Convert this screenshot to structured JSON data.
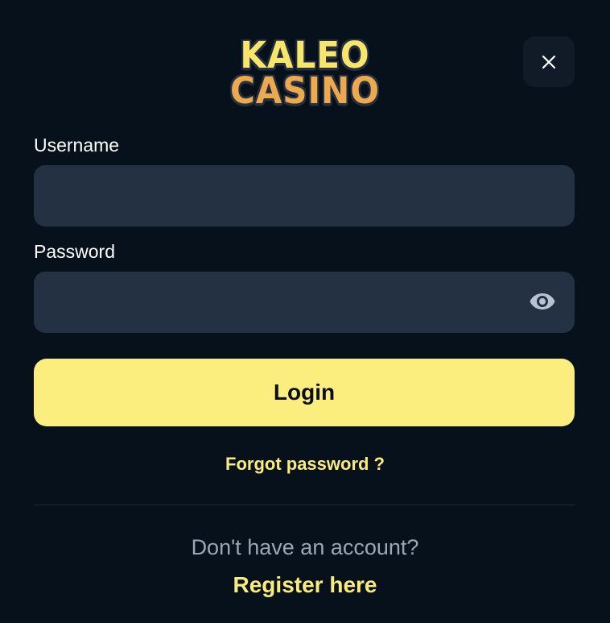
{
  "logo": {
    "line1": "KALEO",
    "line2": "CASINO"
  },
  "header": {
    "close_icon": "close-icon"
  },
  "form": {
    "username_label": "Username",
    "username_value": "",
    "password_label": "Password",
    "password_value": "",
    "password_toggle_icon": "eye-icon",
    "login_label": "Login",
    "forgot_label": "Forgot password ?"
  },
  "footer": {
    "no_account_text": "Don't have an account?",
    "register_label": "Register here"
  },
  "colors": {
    "background": "#07111c",
    "input_background": "#233142",
    "accent_yellow": "#fbee7e",
    "link_yellow": "#fbeb7c",
    "logo_orange": "#eda950",
    "muted_text": "#9ba7b5"
  }
}
